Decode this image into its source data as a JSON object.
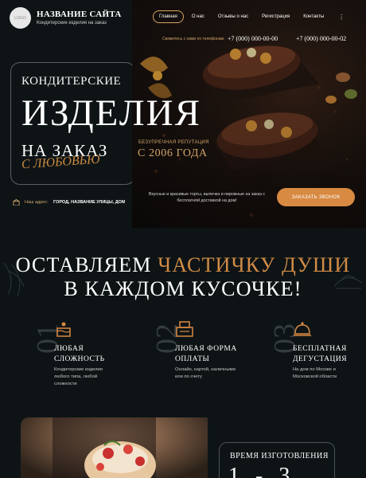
{
  "header": {
    "logo_text": "LOGO",
    "site_name": "НАЗВАНИЕ САЙТА",
    "site_sub": "Кондитерские изделия на заказ",
    "nav": [
      "Главная",
      "О нас",
      "Отзывы о нас",
      "Регистрация",
      "Контакты"
    ],
    "more": "⋮",
    "phone_label": "Свяжитесь с нами по телефонам:",
    "phone1": "+7 (000) 000-00-00",
    "phone2": "+7 (000) 000-00-02"
  },
  "hero": {
    "line1": "КОНДИТЕРСКИЕ",
    "line2": "ИЗДЕЛИЯ",
    "line3": "НА ЗАКАЗ",
    "script": "С ЛЮБОВЬЮ",
    "rep_label": "БЕЗУПРЕЧНАЯ РЕПУТАЦИЯ",
    "rep_year": "С 2006 ГОДА",
    "desc": "Вкусные и красивые торты, выпечка и пирожные на заказ с бесплатной доставкой на дом!",
    "call_button": "ЗАКАЗАТЬ ЗВОНОК",
    "addr_label": "Наш адрес:",
    "addr_text": "ГОРОД, НАЗВАНИЕ УЛИЦЫ, ДОМ 00"
  },
  "section": {
    "title_a": "ОСТАВЛЯЕМ ",
    "title_gold": "ЧАСТИЧКУ ДУШИ",
    "title_b": "В КАЖДОМ КУСОЧКЕ!"
  },
  "features": [
    {
      "num": "01",
      "title1": "ЛЮБАЯ",
      "title2": "СЛОЖНОСТЬ",
      "desc": "Кондитерские изделия любого типа, любой сложности"
    },
    {
      "num": "02",
      "title1": "ЛЮБАЯ ФОРМА",
      "title2": "ОПЛАТЫ",
      "desc": "Онлайн, картой, наличными или по счету"
    },
    {
      "num": "03",
      "title1": "БЕСПЛАТНАЯ",
      "title2": "ДЕГУСТАЦИЯ",
      "desc": "На дом по Москве и Московской области"
    }
  ],
  "bottom": {
    "time_title": "ВРЕМЯ ИЗГОТОВЛЕНИЯ",
    "time_value": "1-3"
  },
  "colors": {
    "accent": "#d88a42",
    "background": "#0e1416",
    "gold_text": "#d1a56a"
  }
}
